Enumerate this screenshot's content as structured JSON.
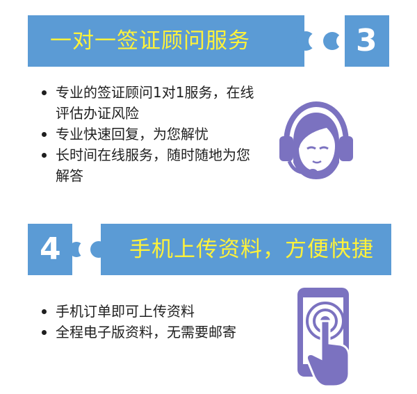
{
  "section1": {
    "title": "一对一签证顾问服务",
    "number": "3",
    "bullets": [
      "专业的签证顾问1对1服务，在线评估办证风险",
      "专业快速回复，为您解忧",
      "长时间在线服务，随时随地为您解答"
    ]
  },
  "section2": {
    "title": "手机上传资料，方便快捷",
    "number": "4",
    "bullets": [
      "手机订单即可上传资料",
      "全程电子版资料，无需要邮寄"
    ]
  },
  "colors": {
    "banner": "#5b9bd5",
    "title_text": "#fff23a",
    "icon": "#7b72c0"
  },
  "icons": [
    "headset-agent-icon",
    "phone-tap-icon"
  ]
}
